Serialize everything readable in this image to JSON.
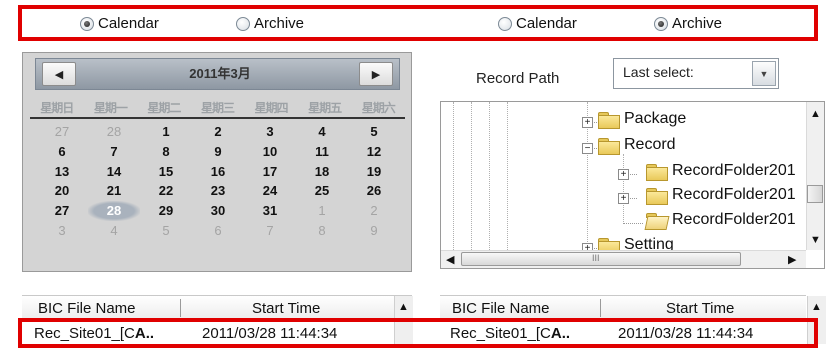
{
  "left_panel": {
    "radio_calendar": "Calendar",
    "radio_archive": "Archive",
    "selected": "Calendar",
    "calendar": {
      "prev_icon": "◀",
      "next_icon": "▶",
      "title": "2011年3月",
      "weekdays": [
        "星期日",
        "星期一",
        "星期二",
        "星期三",
        "星期四",
        "星期五",
        "星期六"
      ],
      "weeks": [
        [
          {
            "d": "27",
            "other": true
          },
          {
            "d": "28",
            "other": true
          },
          {
            "d": "1"
          },
          {
            "d": "2"
          },
          {
            "d": "3"
          },
          {
            "d": "4"
          },
          {
            "d": "5"
          }
        ],
        [
          {
            "d": "6"
          },
          {
            "d": "7"
          },
          {
            "d": "8"
          },
          {
            "d": "9"
          },
          {
            "d": "10"
          },
          {
            "d": "11"
          },
          {
            "d": "12"
          }
        ],
        [
          {
            "d": "13"
          },
          {
            "d": "14"
          },
          {
            "d": "15"
          },
          {
            "d": "16"
          },
          {
            "d": "17"
          },
          {
            "d": "18"
          },
          {
            "d": "19"
          }
        ],
        [
          {
            "d": "20"
          },
          {
            "d": "21"
          },
          {
            "d": "22"
          },
          {
            "d": "23"
          },
          {
            "d": "24"
          },
          {
            "d": "25"
          },
          {
            "d": "26"
          }
        ],
        [
          {
            "d": "27"
          },
          {
            "d": "28",
            "today": true
          },
          {
            "d": "29"
          },
          {
            "d": "30"
          },
          {
            "d": "31"
          },
          {
            "d": "1",
            "other": true
          },
          {
            "d": "2",
            "other": true
          }
        ],
        [
          {
            "d": "3",
            "other": true
          },
          {
            "d": "4",
            "other": true
          },
          {
            "d": "5",
            "other": true
          },
          {
            "d": "6",
            "other": true
          },
          {
            "d": "7",
            "other": true
          },
          {
            "d": "8",
            "other": true
          },
          {
            "d": "9",
            "other": true
          }
        ]
      ]
    },
    "list": {
      "col1": "BIC File Name",
      "col2": "Start Time",
      "row": {
        "name_prefix": "Rec_Site01_[C",
        "name_bold": "A..",
        "start": "2011/03/28 11:44:34"
      }
    }
  },
  "right_panel": {
    "radio_calendar": "Calendar",
    "radio_archive": "Archive",
    "selected": "Archive",
    "record_path_label": "Record Path",
    "record_path_value": "Last select:",
    "dropdown_icon": "▼",
    "tree": [
      {
        "label": "Package"
      },
      {
        "label": "Record"
      },
      {
        "label": "RecordFolder201"
      },
      {
        "label": "RecordFolder201"
      },
      {
        "label": "RecordFolder201"
      },
      {
        "label": "Setting"
      }
    ],
    "hscroll_grip": "III",
    "list": {
      "col1": "BIC File Name",
      "col2": "Start Time",
      "row": {
        "name_prefix": "Rec_Site01_[C",
        "name_bold": "A..",
        "start": "2011/03/28 11:44:34"
      }
    }
  },
  "highlight_color": "#e00000"
}
